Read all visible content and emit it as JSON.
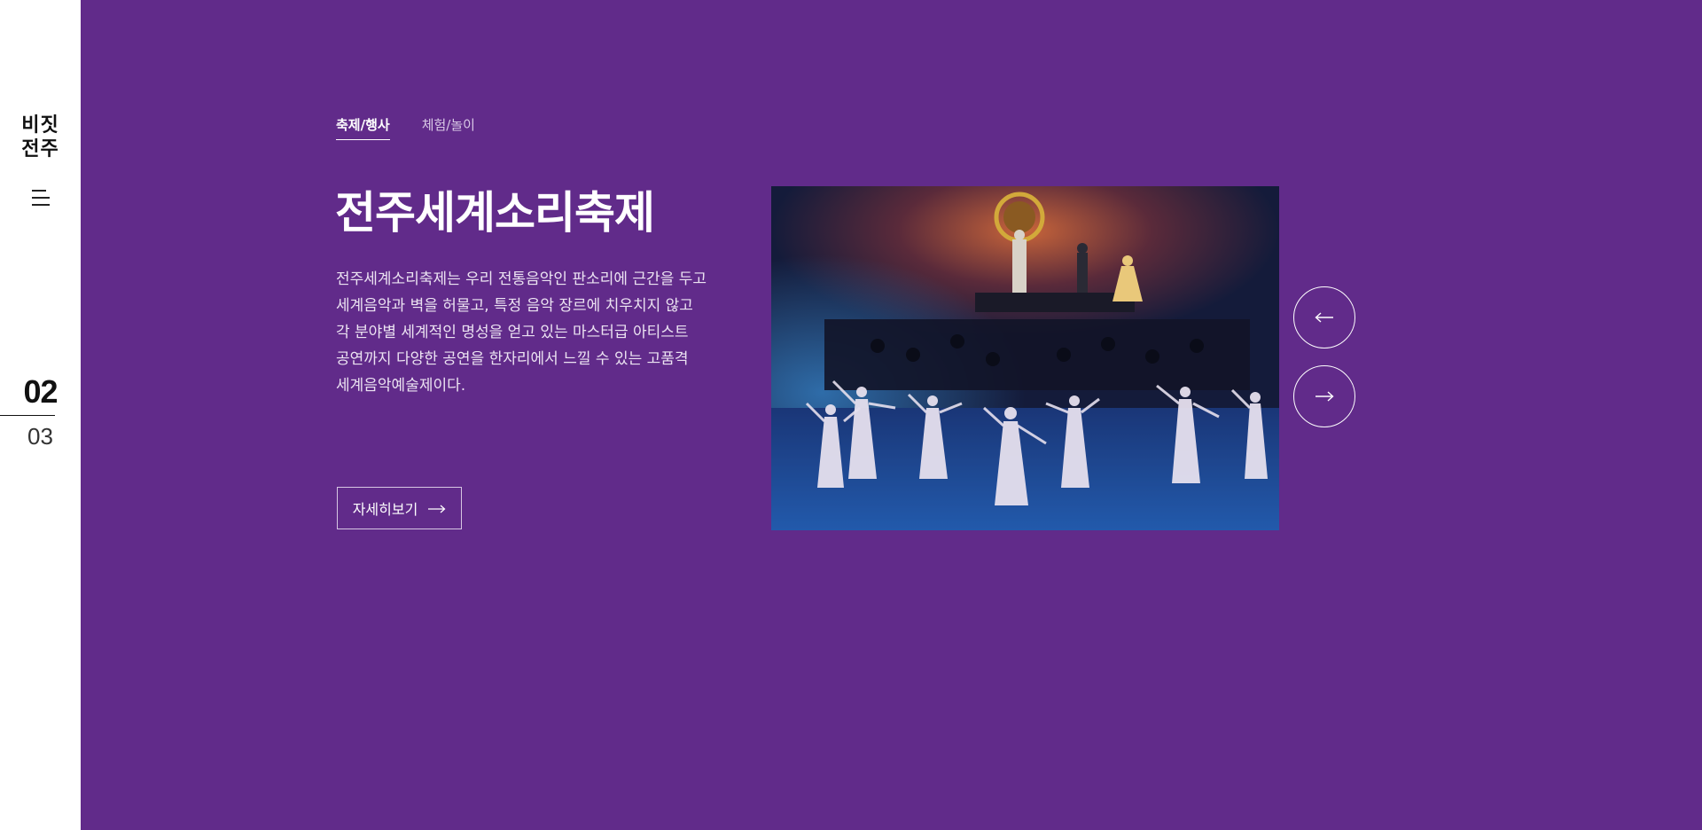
{
  "brand": {
    "logo_line1": "비짓",
    "logo_line2": "전주"
  },
  "menu": {
    "icon": "hamburger-icon"
  },
  "counter": {
    "current": "02",
    "total": "03"
  },
  "tabs": [
    {
      "label": "축제/행사",
      "active": true
    },
    {
      "label": "체험/놀이",
      "active": false
    }
  ],
  "slide": {
    "title": "전주세계소리축제",
    "description": "전주세계소리축제는 우리 전통음악인 판소리에 근간을 두고 세계음악과 벽을 허물고, 특정 음악 장르에 치우치지 않고 각 분야별 세계적인 명성을 얻고 있는 마스터급 아티스트 공연까지 다양한 공연을 한자리에서 느낄 수 있는 고품격 세계음악예술제이다.",
    "more_label": "자세히보기",
    "image_icon": "performance-photo"
  },
  "nav": {
    "prev_icon": "arrow-left-icon",
    "next_icon": "arrow-right-icon"
  },
  "colors": {
    "background": "#612b8a",
    "sidebar": "#ffffff",
    "text": "#ffffff"
  }
}
